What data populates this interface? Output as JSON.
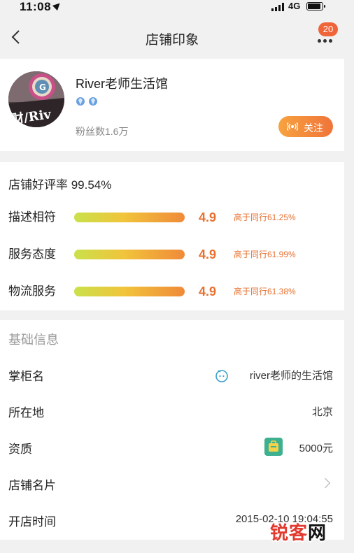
{
  "status_bar": {
    "time": "11:08",
    "network": "4G"
  },
  "nav": {
    "title": "店铺印象",
    "badge": "20"
  },
  "shop": {
    "name": "River老师生活馆",
    "fans": "粉丝数1.6万",
    "follow_label": "关注",
    "avatar_text": "财/Riv"
  },
  "rating": {
    "good_rate": "店铺好评率 99.54%",
    "rows": [
      {
        "label": "描述相符",
        "score": "4.9",
        "compare": "高于同行61.25%"
      },
      {
        "label": "服务态度",
        "score": "4.9",
        "compare": "高于同行61.99%"
      },
      {
        "label": "物流服务",
        "score": "4.9",
        "compare": "高于同行61.38%"
      }
    ]
  },
  "basic_info": {
    "section_title": "基础信息",
    "owner_label": "掌柜名",
    "owner_value": "river老师的生活馆",
    "location_label": "所在地",
    "location_value": "北京",
    "qualification_label": "资质",
    "qualification_value": "5000元",
    "card_label": "店铺名片",
    "open_time_label": "开店时间",
    "open_time_value": "2015-02-10 19:04:55"
  },
  "watermark": {
    "brand_red": "锐客",
    "brand_black": "网"
  },
  "colors": {
    "accent": "#f0743a",
    "score": "#e8702f",
    "badge": "#f0643a"
  }
}
